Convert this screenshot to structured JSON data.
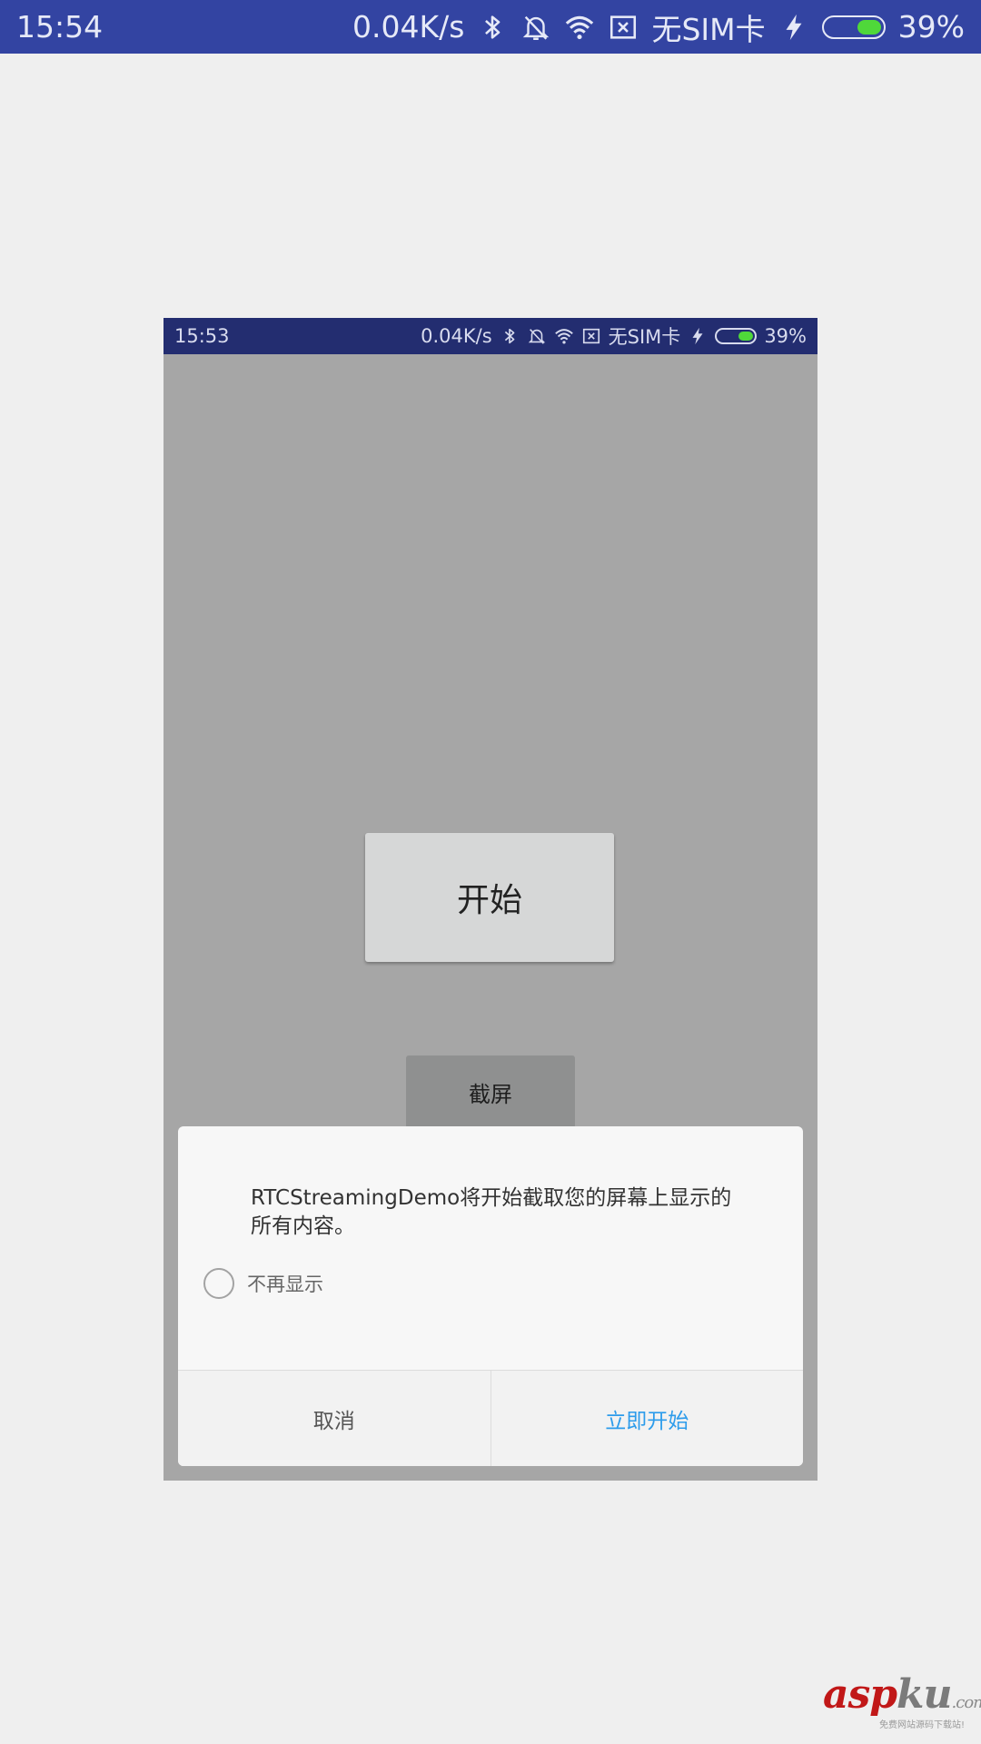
{
  "outer_status": {
    "time": "15:54",
    "net_speed": "0.04K/s",
    "sim": "无SIM卡",
    "battery": "39%",
    "battery_level": 0.39,
    "icons": [
      "bluetooth-icon",
      "bell-off-icon",
      "wifi-icon",
      "sim-x-icon",
      "charging-bolt-icon",
      "battery-icon"
    ]
  },
  "inner_status": {
    "time": "15:53",
    "net_speed": "0.04K/s",
    "sim": "无SIM卡",
    "battery": "39%",
    "battery_level": 0.39
  },
  "main": {
    "start_button": "开始",
    "capture_button": "截屏"
  },
  "dialog": {
    "message": "RTCStreamingDemo将开始截取您的屏幕上显示的所有内容。",
    "dont_show_again": "不再显示",
    "dont_show_again_checked": false,
    "cancel": "取消",
    "confirm": "立即开始"
  },
  "watermark": {
    "brand_part1": "asp",
    "brand_part2": "ku",
    "brand_suffix": ".com",
    "tagline": "免费网站源码下载站!"
  },
  "colors": {
    "status_bar_outer": "#3344a2",
    "status_bar_inner": "#232d70",
    "overlay_bg": "#a6a6a6",
    "confirm_text": "#2d9ceb",
    "battery_fill": "#4fd83a"
  }
}
